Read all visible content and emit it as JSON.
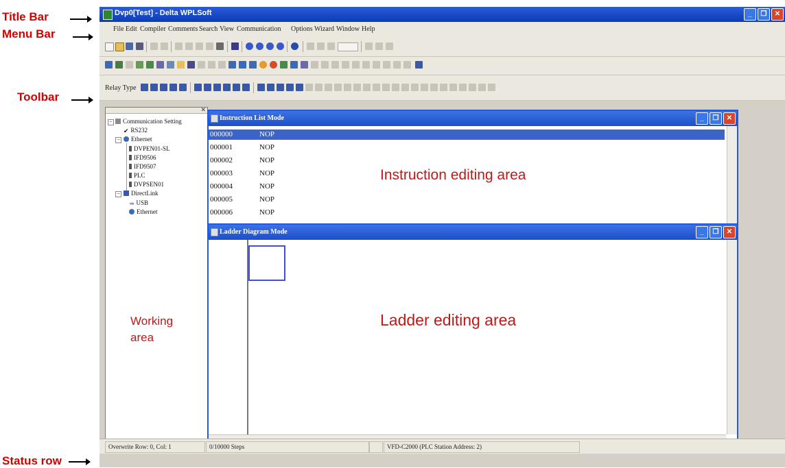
{
  "callouts": {
    "title_bar": "Title Bar",
    "menu_bar": "Menu Bar",
    "toolbar": "Toolbar",
    "status_row": "Status row"
  },
  "app": {
    "title": "Dvp0[Test] - Delta WPLSoft",
    "menu": [
      "File",
      "Edit",
      "Compiler",
      "Comments",
      "Search",
      "View",
      "Communication",
      "Options",
      "Wizard",
      "Window",
      "Help"
    ],
    "relay_type_label": "Relay Type"
  },
  "working_area": {
    "tree": [
      {
        "label": "Communication Setting",
        "icon": "gear-icon"
      },
      {
        "label": "RS232",
        "icon": "checkmark-icon"
      },
      {
        "label": "Ethernet",
        "icon": "network-icon"
      },
      {
        "label": "DVPEN01-SL",
        "icon": "device-icon"
      },
      {
        "label": "IFD9506",
        "icon": "device-icon"
      },
      {
        "label": "IFD9507",
        "icon": "device-icon"
      },
      {
        "label": "PLC",
        "icon": "device-icon"
      },
      {
        "label": "DVPSEN01",
        "icon": "device-icon"
      },
      {
        "label": "DirectLink",
        "icon": "link-icon"
      },
      {
        "label": "USB",
        "icon": "usb-icon"
      },
      {
        "label": "Ethernet",
        "icon": "network-icon"
      }
    ],
    "note": "Working area"
  },
  "instruction_window": {
    "title": "Instruction List Mode",
    "rows": [
      {
        "addr": "000000",
        "ins": "NOP"
      },
      {
        "addr": "000001",
        "ins": "NOP"
      },
      {
        "addr": "000002",
        "ins": "NOP"
      },
      {
        "addr": "000003",
        "ins": "NOP"
      },
      {
        "addr": "000004",
        "ins": "NOP"
      },
      {
        "addr": "000005",
        "ins": "NOP"
      },
      {
        "addr": "000006",
        "ins": "NOP"
      }
    ],
    "note": "Instruction  editing area"
  },
  "ladder_window": {
    "title": "Ladder Diagram Mode",
    "note": "Ladder editing area"
  },
  "status": {
    "mode": "Overwrite",
    "position": "Row: 0, Col: 1",
    "steps": "0/10000 Steps",
    "device": "VFD-C2000 (PLC Station Address: 2)"
  },
  "colors": {
    "titlebar": "#0a3db8",
    "callout_text": "#d40000",
    "selection": "#3a64c8"
  }
}
